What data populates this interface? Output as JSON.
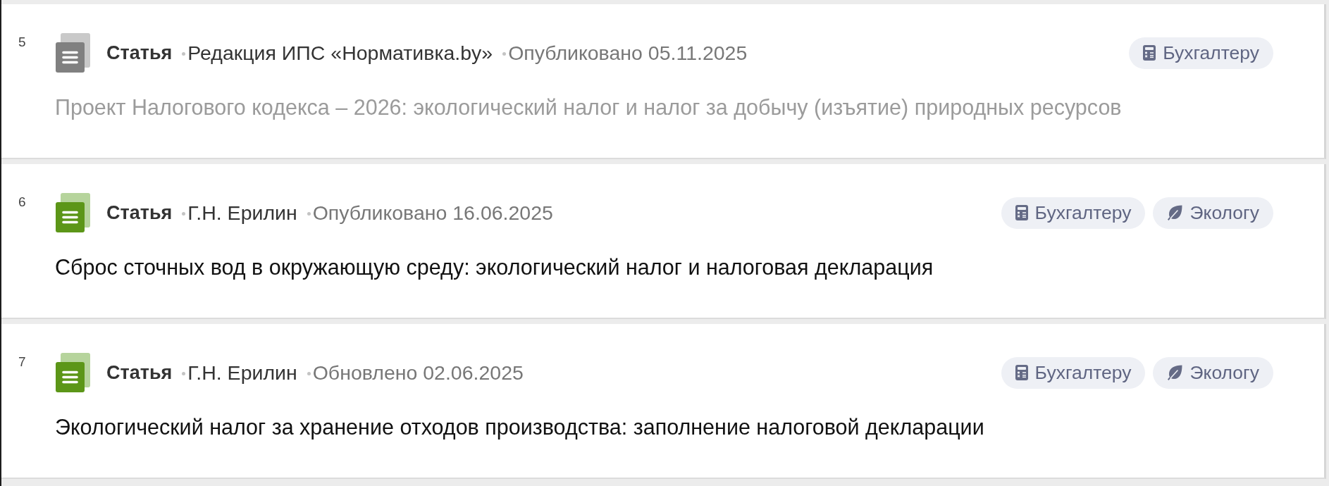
{
  "items": [
    {
      "number": "5",
      "type": "Статья",
      "author": "Редакция ИПС «Нормативка.by»",
      "date": "Опубликовано 05.11.2025",
      "inactive": true,
      "title": "Проект Налогового кодекса – 2026: экологический налог и налог за добычу (изъятие) природных ресурсов",
      "tags": [
        {
          "kind": "accountant",
          "label": "Бухгалтеру"
        }
      ]
    },
    {
      "number": "6",
      "type": "Статья",
      "author": "Г.Н. Ерилин",
      "date": "Опубликовано 16.06.2025",
      "inactive": false,
      "title": "Сброс сточных вод в окружающую среду: экологический налог и налоговая декларация",
      "tags": [
        {
          "kind": "accountant",
          "label": "Бухгалтеру"
        },
        {
          "kind": "ecologist",
          "label": "Экологу"
        }
      ]
    },
    {
      "number": "7",
      "type": "Статья",
      "author": "Г.Н. Ерилин",
      "date": "Обновлено 02.06.2025",
      "inactive": false,
      "title": "Экологический налог за хранение отходов производства: заполнение налоговой декларации",
      "tags": [
        {
          "kind": "accountant",
          "label": "Бухгалтеру"
        },
        {
          "kind": "ecologist",
          "label": "Экологу"
        }
      ]
    }
  ]
}
